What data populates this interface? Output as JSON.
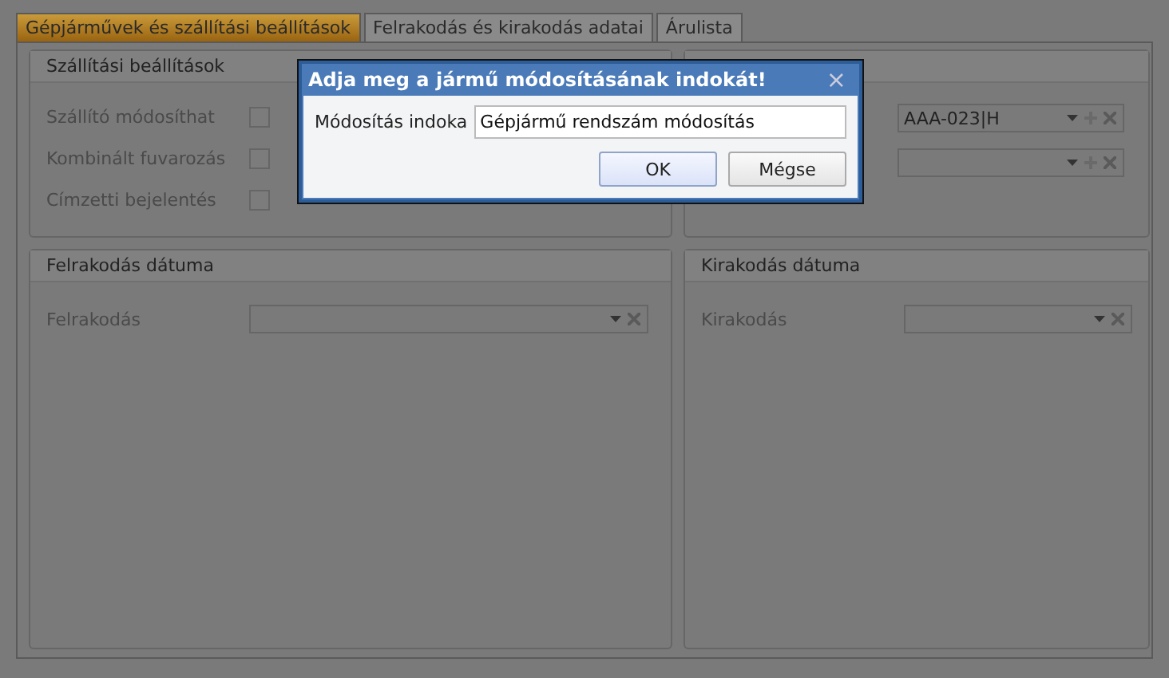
{
  "tabs": [
    {
      "label": "Gépjárművek és szállítási beállítások",
      "selected": true
    },
    {
      "label": "Felrakodás és kirakodás adatai",
      "selected": false
    },
    {
      "label": "Árulista",
      "selected": false
    }
  ],
  "shipping_settings": {
    "title": "Szállítási beállítások",
    "rows": [
      {
        "label": "Szállító módosíthat",
        "checked": false
      },
      {
        "label": "Kombinált fuvarozás",
        "checked": false
      },
      {
        "label": "Címzetti bejelentés",
        "checked": false
      }
    ]
  },
  "vehicles": {
    "combo_value": "AAA-023|H"
  },
  "loading_date": {
    "title": "Felrakodás dátuma",
    "label": "Felrakodás"
  },
  "unloading_date": {
    "title": "Kirakodás dátuma",
    "label": "Kirakodás"
  },
  "dialog": {
    "title": "Adja meg a jármű módosításának indokát!",
    "close": "×",
    "field_label": "Módosítás indoka",
    "field_value": "Gépjármű rendszám módosítás",
    "buttons": [
      {
        "label": "OK",
        "selected": true
      },
      {
        "label": "Mégse",
        "selected": false
      }
    ]
  }
}
